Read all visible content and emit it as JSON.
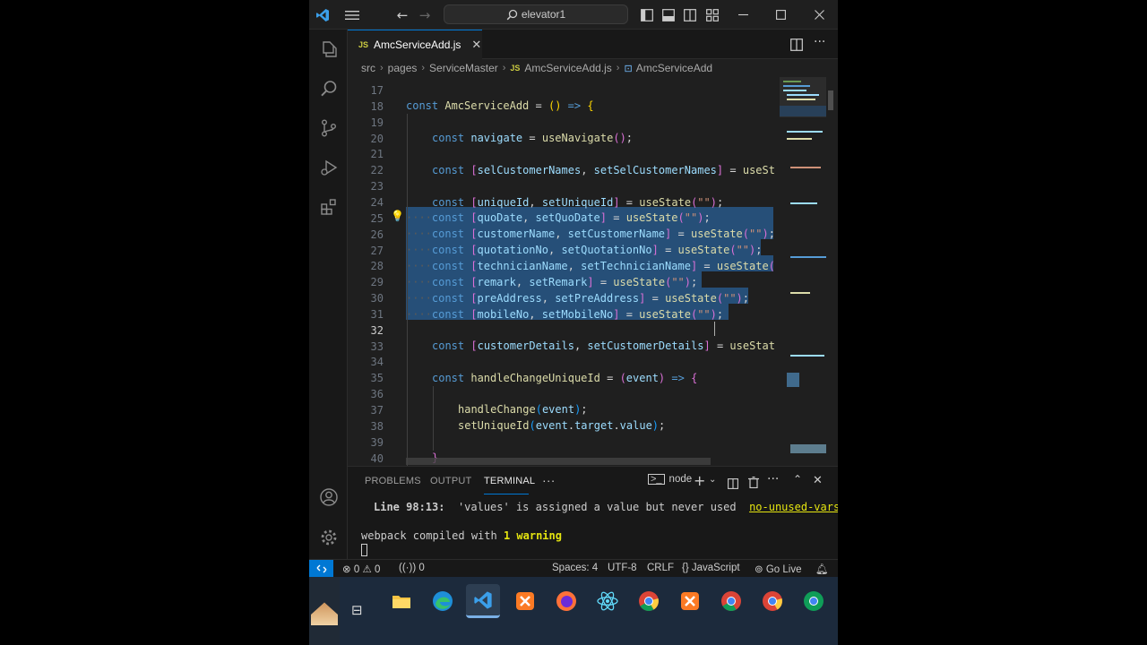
{
  "window": {
    "title": "elevator1"
  },
  "tabs": [
    {
      "label": "AmcServiceAdd.js",
      "badge": "JS"
    }
  ],
  "breadcrumb": [
    "src",
    "pages",
    "ServiceMaster",
    "AmcServiceAdd.js",
    "AmcServiceAdd"
  ],
  "breadcrumb_badge": "JS",
  "editor": {
    "line_numbers": [
      "17",
      "18",
      "19",
      "20",
      "21",
      "22",
      "23",
      "24",
      "25",
      "26",
      "27",
      "28",
      "29",
      "30",
      "31",
      "32",
      "33",
      "34",
      "35",
      "36",
      "37",
      "38",
      "39",
      "40"
    ]
  },
  "panel": {
    "tabs": [
      "PROBLEMS",
      "OUTPUT",
      "TERMINAL"
    ],
    "terminal_profile": "node",
    "lines": {
      "warning_loc": "Line 98:13:",
      "warning_msg": "'values' is assigned a value but never used",
      "warning_rule": "no-unused-vars",
      "compiled_prefix": "webpack compiled with ",
      "compiled_count": "1 warning"
    }
  },
  "statusbar": {
    "errors": "0",
    "warnings": "0",
    "ports": "0",
    "spaces": "Spaces: 4",
    "encoding": "UTF-8",
    "eol": "CRLF",
    "language": "JavaScript",
    "golive": "Go Live"
  },
  "colors": {
    "accent": "#0078d4",
    "selection": "#264f78",
    "keyword": "#569cd6",
    "variable": "#9cdcfe",
    "function": "#dcdcaa",
    "string": "#ce9178"
  }
}
